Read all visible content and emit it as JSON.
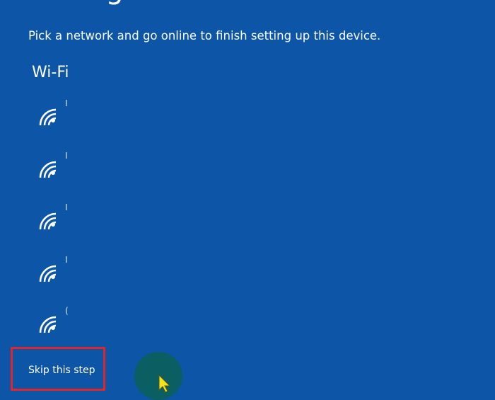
{
  "page": {
    "title": "Let's get connected",
    "subtitle": "Pick a network and go online to finish setting up this device."
  },
  "wifi": {
    "heading": "Wi-Fi",
    "networks": [
      {
        "name": "I",
        "icon": "wifi-signal-icon"
      },
      {
        "name": "I",
        "icon": "wifi-signal-icon"
      },
      {
        "name": "I",
        "icon": "wifi-signal-icon"
      },
      {
        "name": "I",
        "icon": "wifi-signal-icon"
      },
      {
        "name": "(",
        "icon": "wifi-signal-icon"
      }
    ]
  },
  "actions": {
    "skip_label": "Skip this step"
  },
  "colors": {
    "background": "#0d55a7",
    "text": "#ffffff",
    "highlight": "#e0262b",
    "click_indicator": "#0b5e62",
    "cursor": "#f2e51b"
  }
}
